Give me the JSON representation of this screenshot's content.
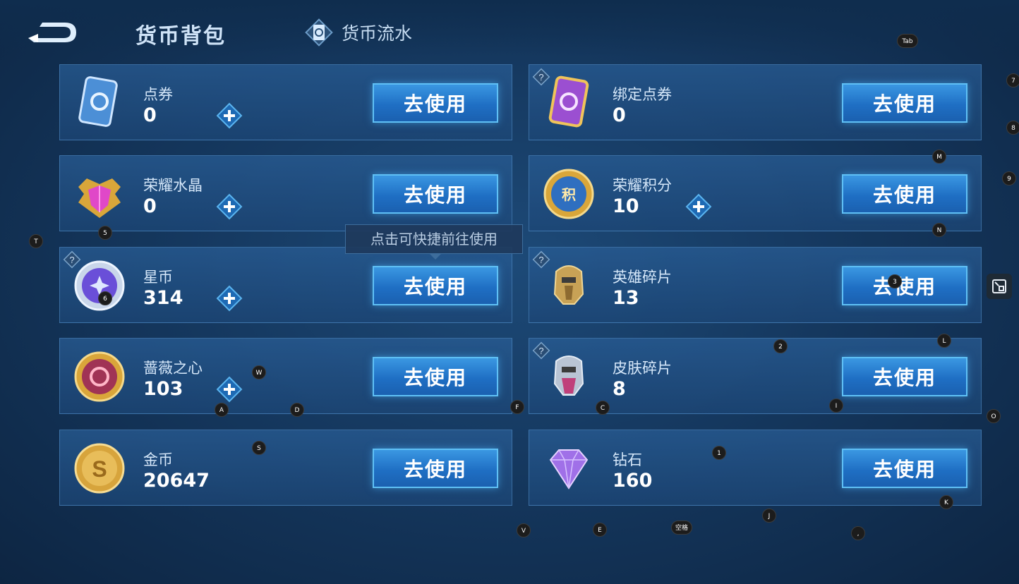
{
  "header": {
    "title": "货币背包",
    "flow_tab_label": "货币流水"
  },
  "currencies": [
    {
      "name": "点券",
      "amount": "0",
      "use_label": "去使用"
    },
    {
      "name": "绑定点券",
      "amount": "0",
      "use_label": "去使用"
    },
    {
      "name": "荣耀水晶",
      "amount": "0",
      "use_label": "去使用"
    },
    {
      "name": "荣耀积分",
      "amount": "10",
      "use_label": "去使用"
    },
    {
      "name": "星币",
      "amount": "314",
      "use_label": "去使用"
    },
    {
      "name": "英雄碎片",
      "amount": "13",
      "use_label": "去使用"
    },
    {
      "name": "蔷薇之心",
      "amount": "103",
      "use_label": "去使用"
    },
    {
      "name": "皮肤碎片",
      "amount": "8",
      "use_label": "去使用"
    },
    {
      "name": "金币",
      "amount": "20647",
      "use_label": "去使用"
    },
    {
      "name": "钻石",
      "amount": "160",
      "use_label": "去使用"
    }
  ],
  "tooltip": "点击可快捷前往使用",
  "key_hints": [
    "Tab",
    "7",
    "8",
    "M",
    "9",
    "T",
    "5",
    "N",
    "6",
    "3",
    "2",
    "L",
    "W",
    "A",
    "D",
    "F",
    "C",
    "I",
    "O",
    "S",
    "1",
    "K",
    "J",
    "V",
    "E",
    "空格",
    ","
  ],
  "colors": {
    "accent": "#2a7fd0",
    "background": "#15385f"
  }
}
